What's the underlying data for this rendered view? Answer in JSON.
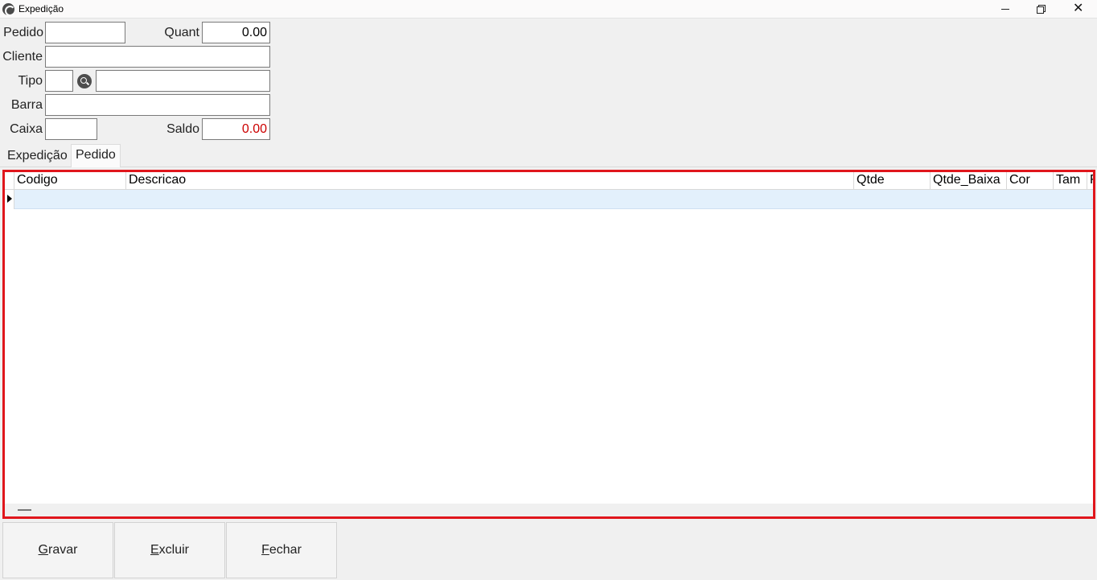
{
  "window": {
    "title": "Expedição",
    "minimize": "—",
    "maximize": "❐",
    "close": "✕"
  },
  "form": {
    "pedido": {
      "label": "Pedido",
      "value": ""
    },
    "quant": {
      "label": "Quant",
      "value": "0.00"
    },
    "cliente": {
      "label": "Cliente",
      "value": ""
    },
    "tipo": {
      "label": "Tipo",
      "code": "",
      "description": ""
    },
    "barra": {
      "label": "Barra",
      "value": ""
    },
    "caixa": {
      "label": "Caixa",
      "value": ""
    },
    "saldo": {
      "label": "Saldo",
      "value": "0.00",
      "color": "#cc0000"
    }
  },
  "tabs": [
    {
      "label": "Expedição",
      "active": false
    },
    {
      "label": "Pedido",
      "active": true
    }
  ],
  "grid": {
    "columns": [
      "Codigo",
      "Descricao",
      "Qtde",
      "Qtde_Baixa",
      "Cor",
      "Tam",
      "F"
    ],
    "rows": [],
    "selected_row_color": "#e3f0fc",
    "highlight_color": "#e0161c"
  },
  "buttons": {
    "gravar": {
      "accel": "G",
      "rest": "ravar"
    },
    "excluir": {
      "accel": "E",
      "rest": "xcluir"
    },
    "fechar": {
      "accel": "F",
      "rest": "echar"
    }
  }
}
